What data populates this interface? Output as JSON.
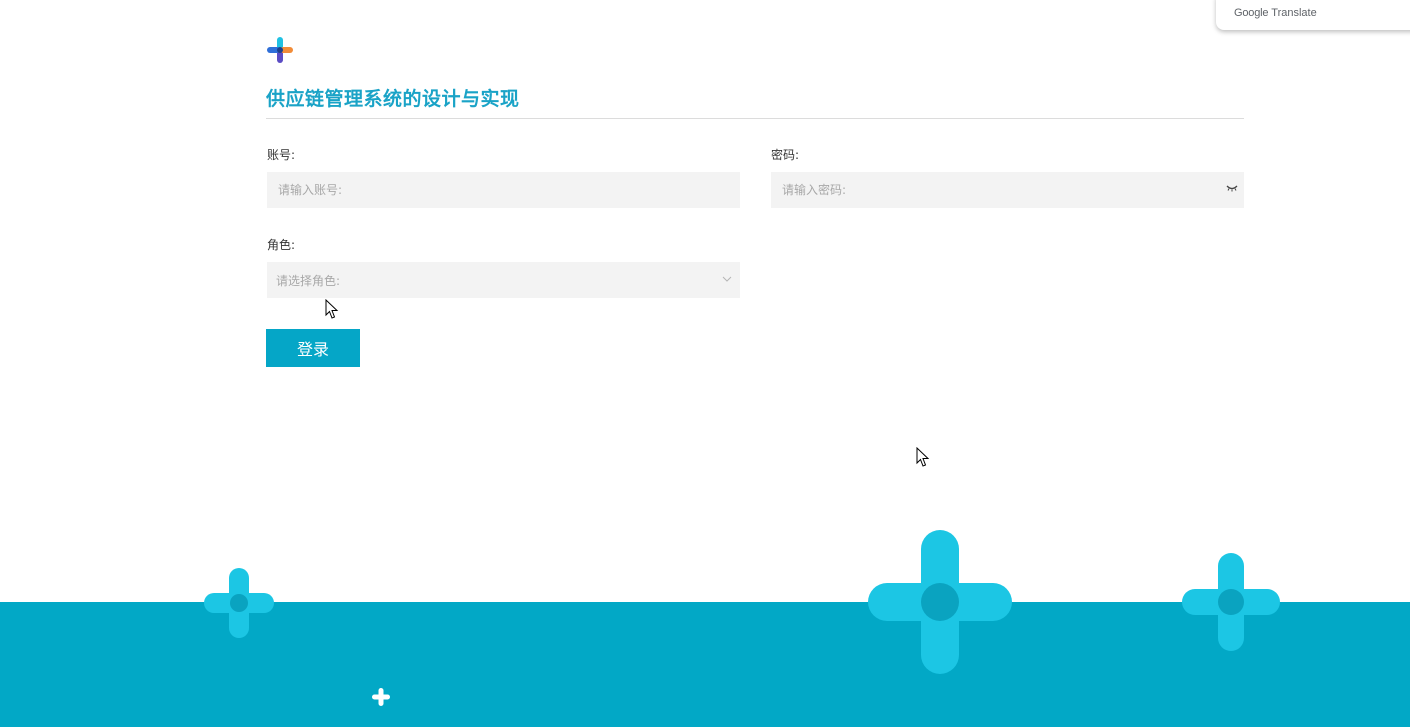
{
  "translate_popup": {
    "brand": "Google",
    "label": "Translate"
  },
  "header": {
    "logo_icon": "plus-logo-icon",
    "title": "供应链管理系统的设计与实现"
  },
  "form": {
    "account": {
      "label": "账号:",
      "placeholder": "请输入账号:",
      "value": ""
    },
    "password": {
      "label": "密码:",
      "placeholder": "请输入密码:",
      "value": "",
      "toggle_icon": "eye-closed-icon"
    },
    "role": {
      "label": "角色:",
      "placeholder": "请选择角色:",
      "selected": "",
      "dropdown_icon": "chevron-down-icon"
    },
    "login_label": "登录"
  },
  "colors": {
    "accent": "#05a6c7",
    "title": "#1aa3c7",
    "input_bg": "#f3f3f3",
    "footer": "#02a8c6",
    "decoration": "#1cc6e4"
  }
}
